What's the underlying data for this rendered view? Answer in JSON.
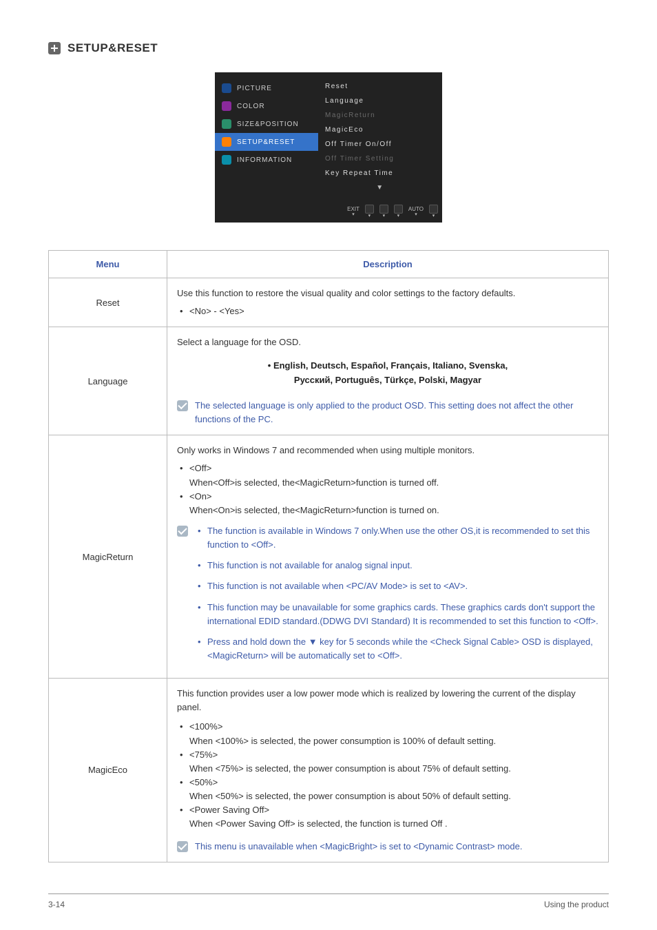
{
  "section": {
    "title": "SETUP&RESET"
  },
  "osd": {
    "left": [
      {
        "label": "PICTURE",
        "color": "#1a4b8f"
      },
      {
        "label": "COLOR",
        "color": "#8a2a9b"
      },
      {
        "label": "SIZE&POSITION",
        "color": "#2a8f6a"
      },
      {
        "label": "SETUP&RESET",
        "color": "#ff8106",
        "selected": true
      },
      {
        "label": "INFORMATION",
        "color": "#0a8faa"
      }
    ],
    "right": [
      {
        "label": "Reset",
        "dim": false
      },
      {
        "label": "Language",
        "dim": false
      },
      {
        "label": "MagicReturn",
        "dim": true
      },
      {
        "label": "MagicEco",
        "dim": false
      },
      {
        "label": "Off Timer On/Off",
        "dim": false
      },
      {
        "label": "Off Timer Setting",
        "dim": true
      },
      {
        "label": "Key Repeat Time",
        "dim": false
      }
    ],
    "bottom": [
      "EXIT",
      "",
      "",
      "",
      "AUTO",
      ""
    ]
  },
  "table": {
    "headers": {
      "menu": "Menu",
      "desc": "Description"
    },
    "reset": {
      "name": "Reset",
      "intro": "Use this function to restore the visual quality and color settings to the factory defaults.",
      "opt": "<No> - <Yes>"
    },
    "language": {
      "name": "Language",
      "intro": "Select a language for the OSD.",
      "langs_line1": "• English, Deutsch, Español, Français, Italiano, Svenska,",
      "langs_line2": "Русский, Português, Türkçe, Polski, Magyar",
      "note": "The selected language is only applied to the product OSD. This setting does not affect the other functions of the PC."
    },
    "magicreturn": {
      "name": "MagicReturn",
      "intro": "Only works in Windows 7 and recommended when using multiple monitors.",
      "off_label": "<Off>",
      "off_desc": "When<Off>is selected, the<MagicReturn>function is turned off.",
      "on_label": "<On>",
      "on_desc": "When<On>is selected, the<MagicReturn>function is turned on.",
      "notes": [
        "The function is available in Windows 7 only.When use the other OS,it is recommended to set this function to <Off>.",
        "This function is not available for analog signal input.",
        "This function is not available when <PC/AV Mode> is set to <AV>.",
        "This function may be unavailable for some graphics cards. These graphics cards don't support the international EDID standard.(DDWG DVI Standard) It is recommended to set this function to <Off>.",
        "Press and hold down the ▼ key for 5 seconds while the <Check Signal Cable> OSD is displayed,<MagicReturn> will be automatically set to <Off>."
      ]
    },
    "magiceco": {
      "name": "MagicEco",
      "intro": "This function provides user a low power mode which is realized by lowering the current of the display panel.",
      "opts": [
        {
          "h": "<100%>",
          "d": "When <100%> is selected, the power consumption is 100% of default setting."
        },
        {
          "h": "<75%>",
          "d": "When <75%> is selected, the power consumption is about 75% of default setting."
        },
        {
          "h": "<50%>",
          "d": "When <50%> is selected, the power consumption is about 50% of default setting."
        },
        {
          "h": "<Power Saving Off>",
          "d": "When <Power Saving Off> is selected, the function is turned Off ."
        }
      ],
      "note": "This menu is unavailable when <MagicBright> is set to <Dynamic Contrast> mode."
    }
  },
  "footer": {
    "left": "3-14",
    "right": "Using the product"
  }
}
